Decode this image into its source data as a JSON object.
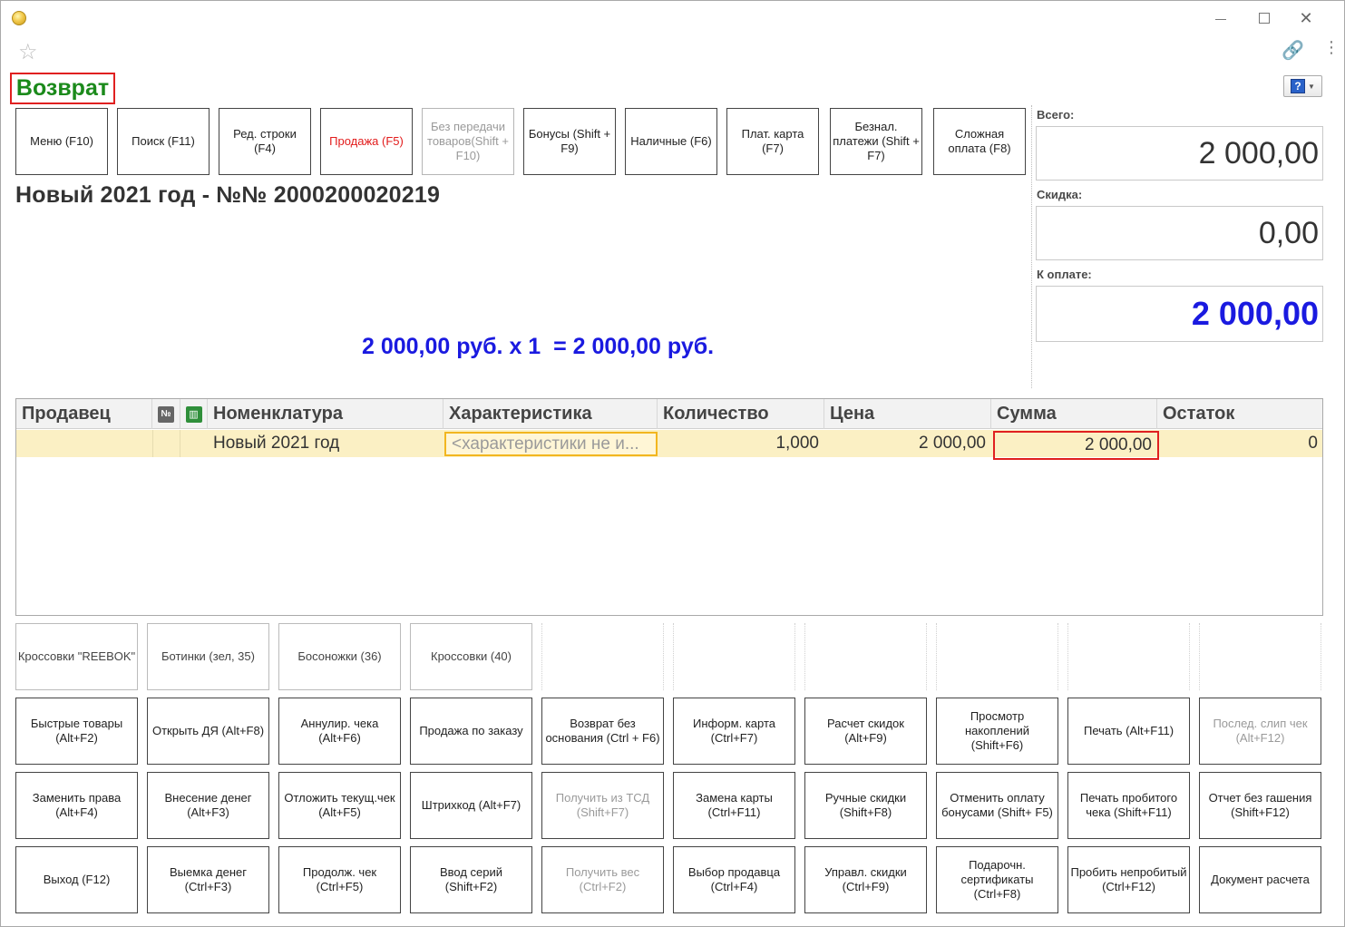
{
  "window": {
    "minimize": "–",
    "maximize": "□",
    "close": "✕"
  },
  "toolbar": {
    "star": "☆",
    "link": "🔗",
    "more": "⋮",
    "help": "?"
  },
  "form_title": "Возврат",
  "commands": [
    {
      "label": "Меню (F10)",
      "state": "normal"
    },
    {
      "label": "Поиск (F11)",
      "state": "normal"
    },
    {
      "label": "Ред. строки (F4)",
      "state": "normal"
    },
    {
      "label": "Продажа (F5)",
      "state": "red"
    },
    {
      "label": "Без передачи товаров(Shift + F10)",
      "state": "disabled"
    },
    {
      "label": "Бонусы (Shift + F9)",
      "state": "normal"
    },
    {
      "label": "Наличные (F6)",
      "state": "normal"
    },
    {
      "label": "Плат. карта (F7)",
      "state": "normal"
    },
    {
      "label": "Безнал. платежи (Shift + F7)",
      "state": "normal"
    },
    {
      "label": "Сложная оплата (F8)",
      "state": "normal"
    }
  ],
  "doc_title": "Новый 2021 год - №№ 2000200020219",
  "calc_line": "2 000,00 руб. х 1  = 2 000,00 руб.",
  "totals": {
    "total_label": "Всего:",
    "total_value": "2 000,00",
    "discount_label": "Скидка:",
    "discount_value": "0,00",
    "topay_label": "К оплате:",
    "topay_value": "2 000,00"
  },
  "table": {
    "headers": {
      "seller": "Продавец",
      "num_icon": "№",
      "barcode_icon": "▥",
      "nomenclature": "Номенклатура",
      "characteristic": "Характеристика",
      "quantity": "Количество",
      "price": "Цена",
      "sum": "Сумма",
      "rest": "Остаток"
    },
    "rows": [
      {
        "seller": "",
        "nomenclature": "Новый 2021 год",
        "characteristic": "<характеристики не и...",
        "quantity": "1,000",
        "price": "2 000,00",
        "sum": "2 000,00",
        "rest": "0"
      }
    ]
  },
  "quick_goods": [
    "Кроссовки \"REEBOK\"",
    "Ботинки (зел, 35)",
    "Босоножки (36)",
    "Кроссовки (40)"
  ],
  "function_buttons": [
    [
      {
        "label": "Быстрые товары (Alt+F2)",
        "state": "normal"
      },
      {
        "label": "Открыть ДЯ (Alt+F8)",
        "state": "normal"
      },
      {
        "label": "Аннулир. чека (Alt+F6)",
        "state": "normal"
      },
      {
        "label": "Продажа по заказу",
        "state": "normal"
      },
      {
        "label": "Возврат без основания (Ctrl + F6)",
        "state": "normal"
      },
      {
        "label": "Информ. карта (Ctrl+F7)",
        "state": "normal"
      },
      {
        "label": "Расчет скидок (Alt+F9)",
        "state": "normal"
      },
      {
        "label": "Просмотр накоплений (Shift+F6)",
        "state": "normal"
      },
      {
        "label": "Печать (Alt+F11)",
        "state": "normal"
      },
      {
        "label": "Послед. слип чек (Alt+F12)",
        "state": "disabled"
      }
    ],
    [
      {
        "label": "Заменить права (Alt+F4)",
        "state": "normal"
      },
      {
        "label": "Внесение денег (Alt+F3)",
        "state": "normal"
      },
      {
        "label": "Отложить текущ.чек (Alt+F5)",
        "state": "normal"
      },
      {
        "label": "Штрихкод (Alt+F7)",
        "state": "normal"
      },
      {
        "label": "Получить из ТСД (Shift+F7)",
        "state": "disabled"
      },
      {
        "label": "Замена карты (Ctrl+F11)",
        "state": "normal"
      },
      {
        "label": "Ручные скидки (Shift+F8)",
        "state": "normal"
      },
      {
        "label": "Отменить оплату бонусами (Shift+ F5)",
        "state": "normal"
      },
      {
        "label": "Печать пробитого чека (Shift+F11)",
        "state": "normal"
      },
      {
        "label": "Отчет без гашения (Shift+F12)",
        "state": "normal"
      }
    ],
    [
      {
        "label": "Выход (F12)",
        "state": "normal"
      },
      {
        "label": "Выемка денег (Ctrl+F3)",
        "state": "normal"
      },
      {
        "label": "Продолж. чек (Ctrl+F5)",
        "state": "normal"
      },
      {
        "label": "Ввод серий (Shift+F2)",
        "state": "normal"
      },
      {
        "label": "Получить вес (Ctrl+F2)",
        "state": "disabled"
      },
      {
        "label": "Выбор продавца (Ctrl+F4)",
        "state": "normal"
      },
      {
        "label": "Управл. скидки (Ctrl+F9)",
        "state": "normal"
      },
      {
        "label": "Подарочн. сертификаты (Ctrl+F8)",
        "state": "normal"
      },
      {
        "label": "Пробить непробитый (Ctrl+F12)",
        "state": "normal"
      },
      {
        "label": "Документ расчета",
        "state": "normal"
      }
    ]
  ],
  "colors": {
    "title_green": "#1b8a1b",
    "accent_red": "#e21b1b",
    "amount_blue": "#1a1ae0",
    "row_highlight": "#fbf0c4",
    "cell_focus": "#f2b61f"
  }
}
